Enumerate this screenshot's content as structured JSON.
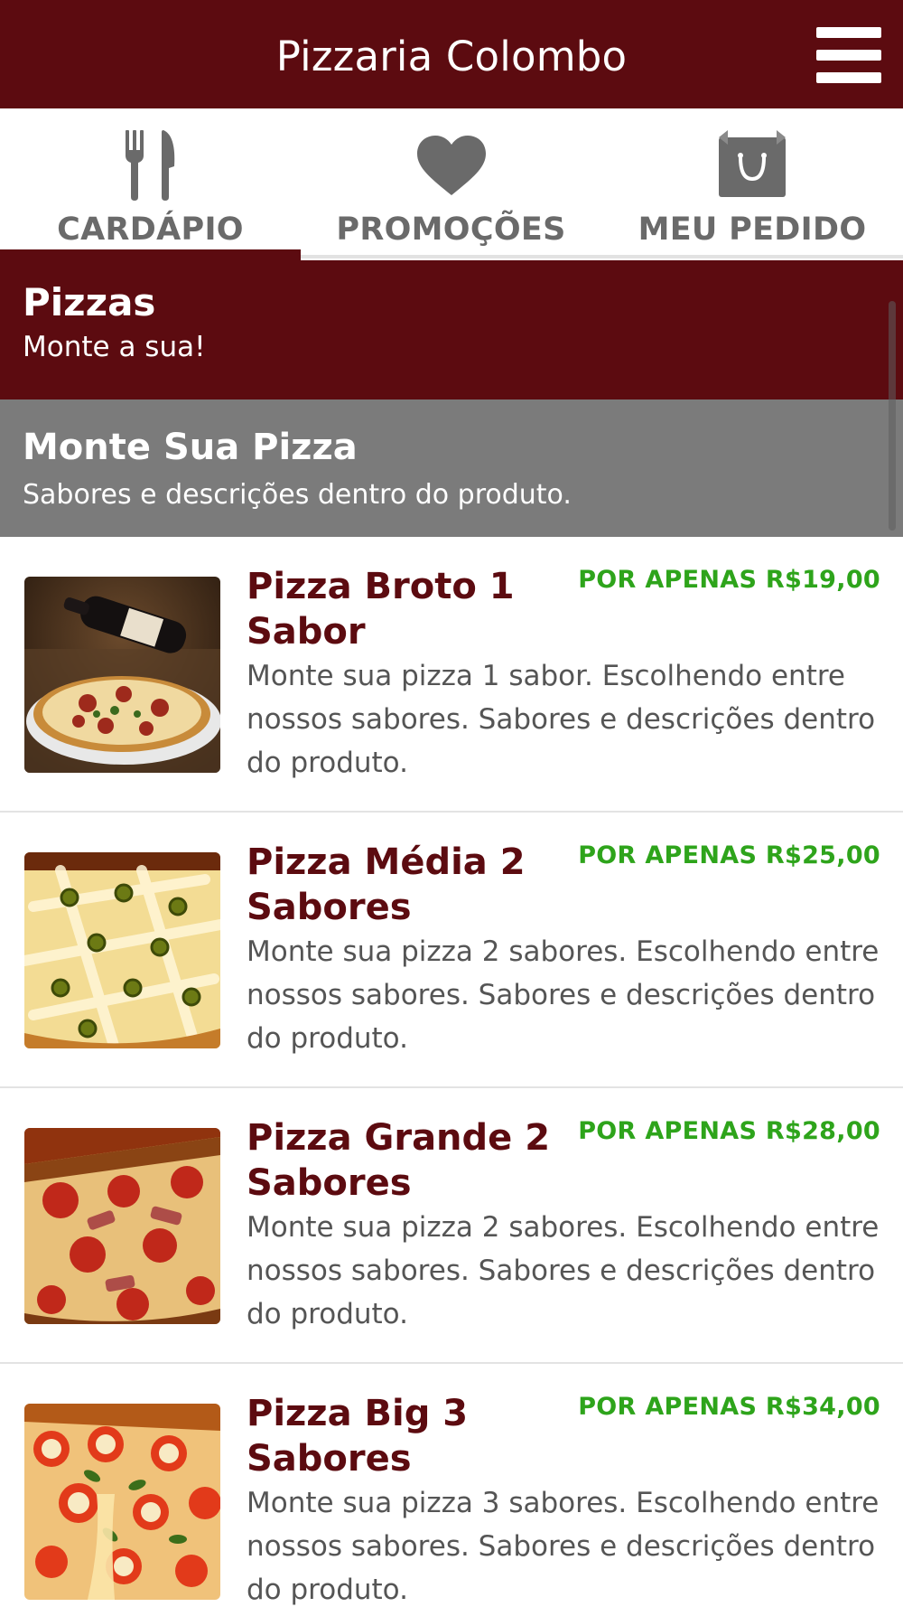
{
  "appbar": {
    "title": "Pizzaria Colombo"
  },
  "tabs": [
    {
      "label": "CARDÁPIO",
      "icon": "utensils-icon",
      "active": true
    },
    {
      "label": "PROMOÇÕES",
      "icon": "heart-icon",
      "active": false
    },
    {
      "label": "MEU PEDIDO",
      "icon": "shopping-bag-icon",
      "active": false
    }
  ],
  "section": {
    "title": "Pizzas",
    "subtitle": "Monte a sua!"
  },
  "subsection": {
    "title": "Monte Sua Pizza",
    "subtitle": "Sabores e descrições dentro do produto."
  },
  "items": [
    {
      "title": "Pizza Broto 1 Sabor",
      "price": "POR APENAS R$19,00",
      "description": "Monte sua pizza 1 sabor. Escolhendo entre nossos sabores. Sabores e descrições dentro do produto.",
      "image": "pizza-with-wine-photo"
    },
    {
      "title": "Pizza Média 2 Sabores",
      "price": "POR APENAS R$25,00",
      "description": "Monte sua pizza 2 sabores. Escolhendo entre nossos sabores. Sabores e descrições dentro do produto.",
      "image": "cheese-olive-pizza-photo"
    },
    {
      "title": "Pizza Grande 2 Sabores",
      "price": "POR APENAS R$28,00",
      "description": "Monte sua pizza 2 sabores. Escolhendo entre nossos sabores. Sabores e descrições dentro do produto.",
      "image": "pepperoni-tomato-pizza-photo"
    },
    {
      "title": "Pizza Big 3 Sabores",
      "price": "POR APENAS R$34,00",
      "description": "Monte sua pizza 3 sabores. Escolhendo entre nossos sabores. Sabores e descrições dentro do produto.",
      "image": "margherita-pizza-photo"
    }
  ],
  "colors": {
    "brand": "#5c0b10",
    "price": "#2ea41b",
    "tab_text": "#6a6a6a",
    "subsection_bg": "#7b7b7b"
  }
}
